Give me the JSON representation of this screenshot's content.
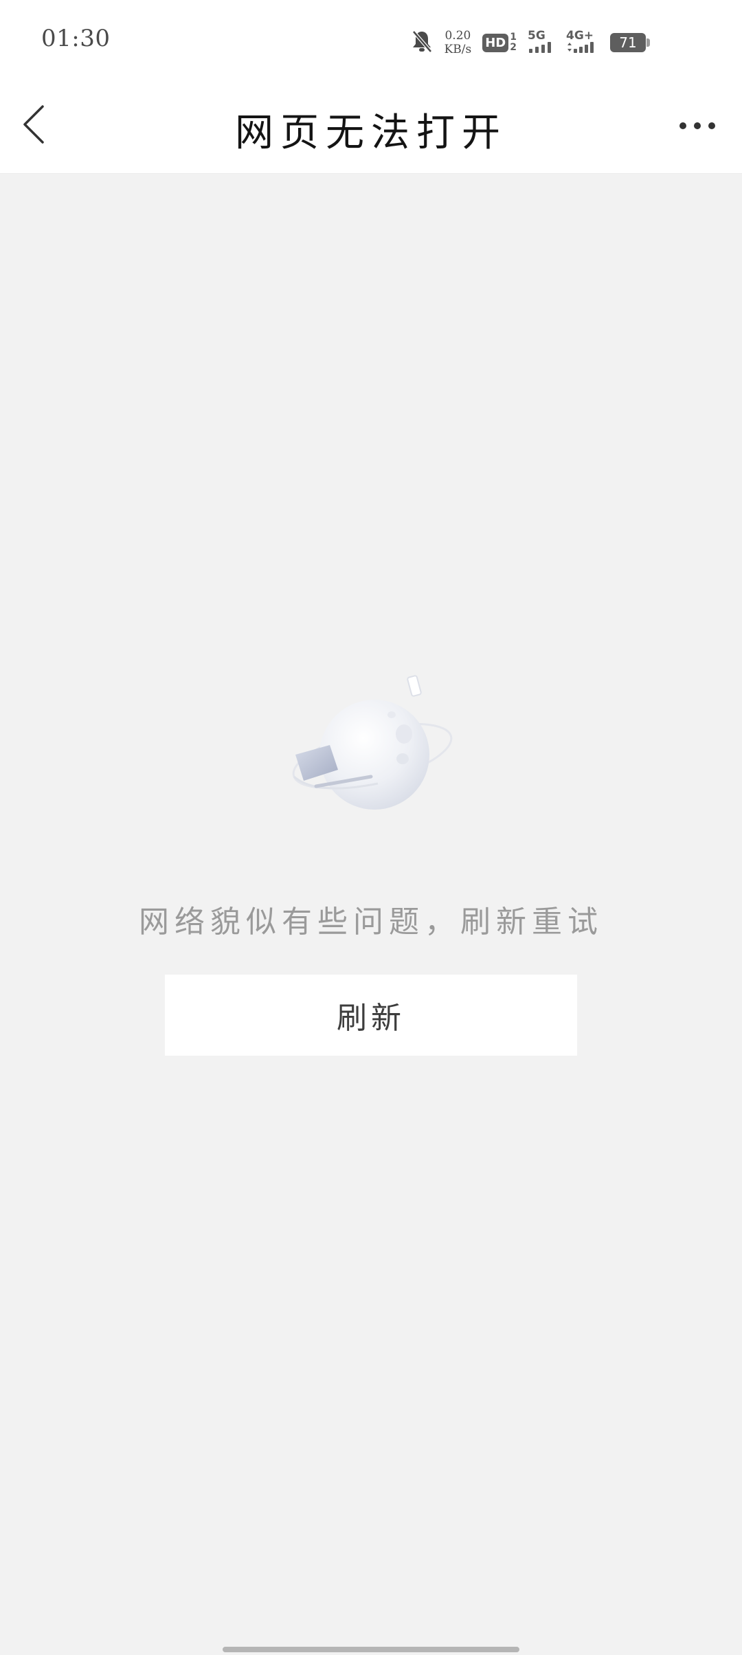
{
  "status_bar": {
    "time": "01:30",
    "net_speed_value": "0.20",
    "net_speed_unit": "KB/s",
    "hd_label": "HD",
    "sim_label_1": "1",
    "sim_label_2": "2",
    "network_5g": "5G",
    "network_4g": "4G+",
    "battery_level": "71"
  },
  "nav": {
    "title": "网页无法打开"
  },
  "main": {
    "error_message": "网络貌似有些问题，刷新重试",
    "refresh_label": "刷新"
  },
  "colors": {
    "background": "#f2f2f2",
    "bar_background": "#ffffff",
    "title_text": "#141414",
    "message_text": "#9a9a9a"
  },
  "icons": {
    "back": "chevron-left-icon",
    "more": "more-dots-icon",
    "mute": "bell-off-icon",
    "illustration": "planet-laptop-illustration"
  }
}
